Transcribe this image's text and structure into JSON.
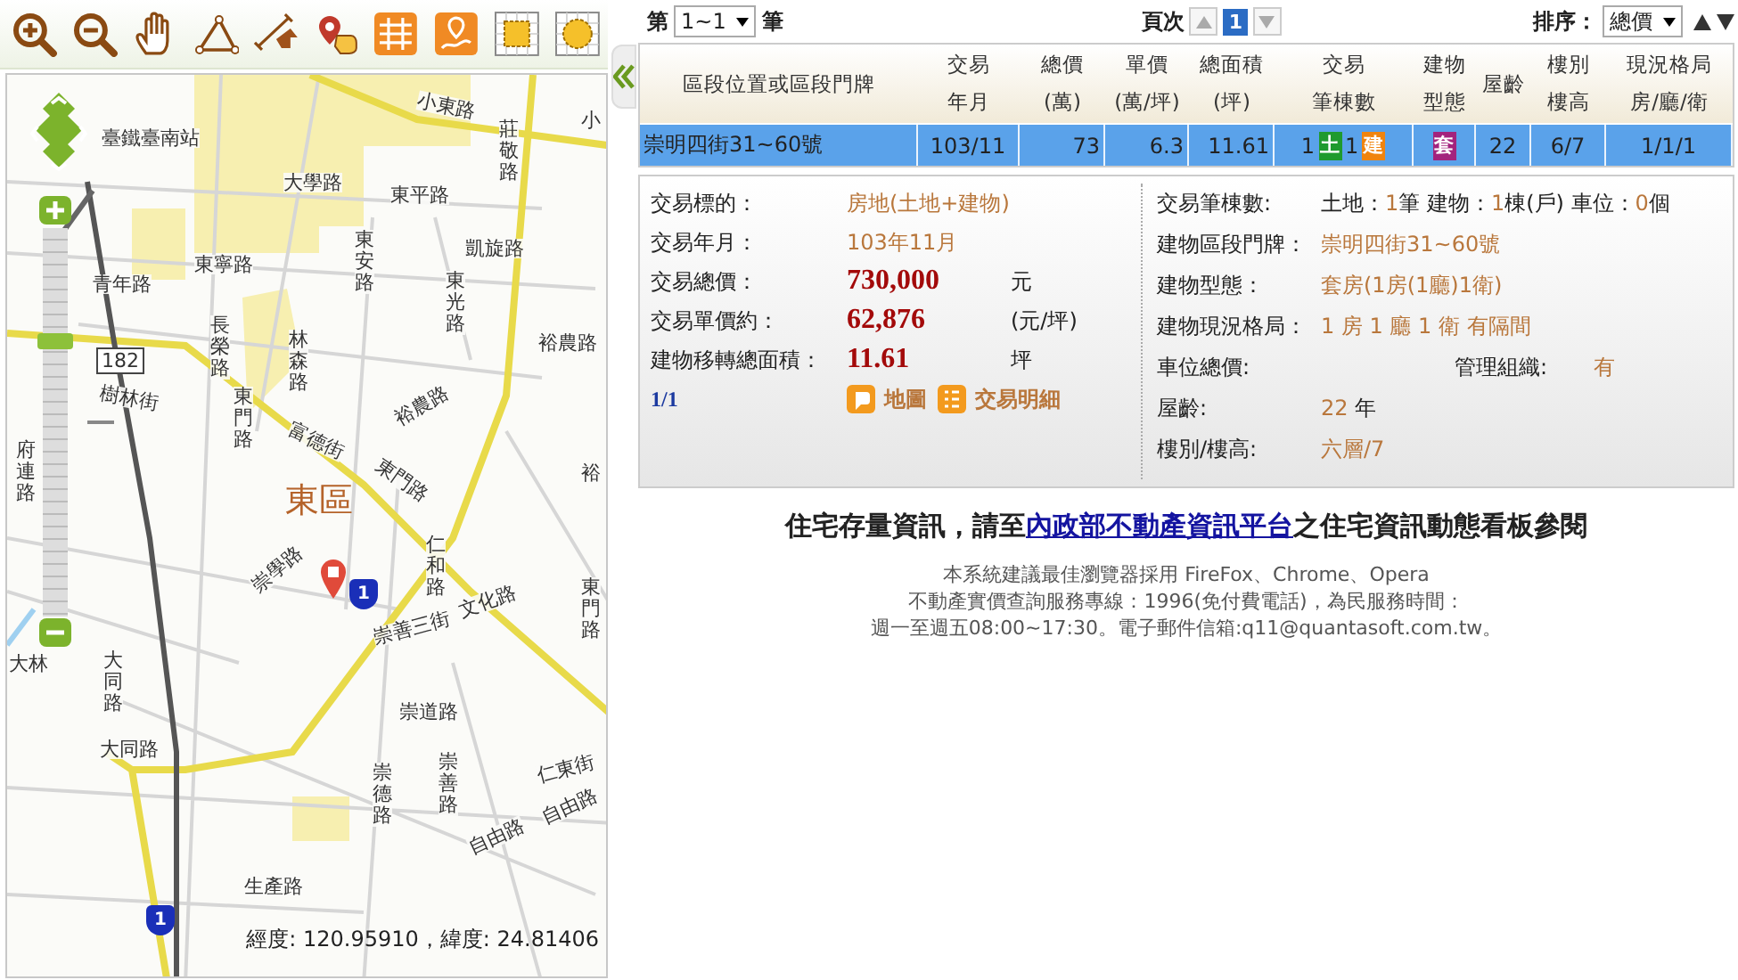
{
  "map": {
    "labels": [
      {
        "text": "臺鐵臺南站",
        "kind": "horizontal"
      },
      {
        "text": "小東路",
        "kind": "horizontal"
      },
      {
        "text": "莊敬路",
        "kind": "vertical"
      },
      {
        "text": "小",
        "kind": "horizontal"
      },
      {
        "text": "大學路",
        "kind": "horizontal"
      },
      {
        "text": "東平路",
        "kind": "horizontal"
      },
      {
        "text": "東安路",
        "kind": "vertical"
      },
      {
        "text": "凱旋路",
        "kind": "horizontal"
      },
      {
        "text": "青年路",
        "kind": "horizontal"
      },
      {
        "text": "東寧路",
        "kind": "horizontal"
      },
      {
        "text": "東光路",
        "kind": "vertical"
      },
      {
        "text": "長榮路",
        "kind": "vertical"
      },
      {
        "text": "林森路",
        "kind": "vertical"
      },
      {
        "text": "裕農路",
        "kind": "horizontal"
      },
      {
        "text": "182",
        "kind": "shield"
      },
      {
        "text": "樹林街",
        "kind": "horizontal"
      },
      {
        "text": "裕農路",
        "kind": "horizontal"
      },
      {
        "text": "東門路",
        "kind": "vertical"
      },
      {
        "text": "府連路",
        "kind": "vertical"
      },
      {
        "text": "富德街",
        "kind": "horizontal"
      },
      {
        "text": "東門路",
        "kind": "horizontal"
      },
      {
        "text": "裕",
        "kind": "horizontal"
      },
      {
        "text": "東區",
        "kind": "district"
      },
      {
        "text": "崇學路",
        "kind": "horizontal"
      },
      {
        "text": "仁和路",
        "kind": "vertical"
      },
      {
        "text": "1",
        "kind": "highway"
      },
      {
        "text": "東門路",
        "kind": "vertical"
      },
      {
        "text": "崇善三街",
        "kind": "horizontal"
      },
      {
        "text": "文化路",
        "kind": "horizontal"
      },
      {
        "text": "大林",
        "kind": "horizontal"
      },
      {
        "text": "大同路",
        "kind": "vertical"
      },
      {
        "text": "大同路",
        "kind": "horizontal"
      },
      {
        "text": "崇道路",
        "kind": "horizontal"
      },
      {
        "text": "崇德路",
        "kind": "vertical"
      },
      {
        "text": "崇善路",
        "kind": "vertical"
      },
      {
        "text": "仁東街",
        "kind": "horizontal"
      },
      {
        "text": "自由路",
        "kind": "horizontal"
      },
      {
        "text": "自由路",
        "kind": "horizontal"
      },
      {
        "text": "生產路",
        "kind": "horizontal"
      },
      {
        "text": "1",
        "kind": "highway"
      }
    ],
    "zoom": {
      "level": 0.72
    },
    "coordinates": "經度: 120.95910，緯度: 24.81406"
  },
  "pager": {
    "prefix": "第",
    "range": "1~1",
    "suffix": "筆",
    "page_label": "頁次",
    "page": "1",
    "sort_label": "排序：",
    "sort_value": "總價"
  },
  "table": {
    "columns": [
      {
        "lines": [
          "區段位置或區段門牌"
        ]
      },
      {
        "lines": [
          "交易",
          "年月"
        ]
      },
      {
        "lines": [
          "總價",
          "(萬)"
        ]
      },
      {
        "lines": [
          "單價",
          "(萬/坪)"
        ]
      },
      {
        "lines": [
          "總面積",
          "(坪)"
        ]
      },
      {
        "lines": [
          "交易",
          "筆棟數"
        ]
      },
      {
        "lines": [
          "建物",
          "型態"
        ]
      },
      {
        "lines": [
          "屋齡"
        ]
      },
      {
        "lines": [
          "樓別",
          "樓高"
        ]
      },
      {
        "lines": [
          "現況格局",
          "房/廳/衛"
        ]
      }
    ],
    "rows": [
      {
        "selected": true,
        "cells": [
          {
            "kind": "text",
            "text": "崇明四街31~60號"
          },
          {
            "kind": "text",
            "text": "103/11"
          },
          {
            "kind": "number",
            "text": "73"
          },
          {
            "kind": "number",
            "text": "6.3"
          },
          {
            "kind": "number",
            "text": "11.61"
          },
          {
            "kind": "badges",
            "items": [
              {
                "count": "1",
                "badge": "土",
                "color": "#1f9a2e"
              },
              {
                "count": "1",
                "badge": "建",
                "color": "#f0840e"
              }
            ]
          },
          {
            "kind": "badges",
            "items": [
              {
                "badge": "套",
                "color": "#a3237d"
              }
            ]
          },
          {
            "kind": "text",
            "text": "22"
          },
          {
            "kind": "text",
            "text": "6/7"
          },
          {
            "kind": "text",
            "text": "1/1/1"
          }
        ]
      }
    ]
  },
  "details": {
    "left": [
      {
        "kind": "plain",
        "label": "交易標的：",
        "value": "房地(土地+建物)"
      },
      {
        "kind": "plain",
        "label": "交易年月：",
        "value": "103年11月"
      },
      {
        "kind": "price",
        "label": "交易總價：",
        "value": "730,000",
        "unit": "元"
      },
      {
        "kind": "price",
        "label": "交易單價約：",
        "value": "62,876",
        "unit": "(元/坪)"
      },
      {
        "kind": "price",
        "label": "建物移轉總面積：",
        "value": "11.61",
        "unit": "坪"
      }
    ],
    "index": "1/1",
    "links": [
      {
        "kind": "map",
        "text": "地圖"
      },
      {
        "kind": "list",
        "text": "交易明細"
      }
    ],
    "right": [
      {
        "label": "交易筆棟數:",
        "parts": [
          {
            "text": "土地：",
            "accent": false
          },
          {
            "text": "1",
            "accent": true
          },
          {
            "text": "筆 建物：",
            "accent": false
          },
          {
            "text": "1",
            "accent": true
          },
          {
            "text": "棟(戶) 車位：",
            "accent": false
          },
          {
            "text": "0",
            "accent": true
          },
          {
            "text": "個",
            "accent": false
          }
        ]
      },
      {
        "label": "建物區段門牌：",
        "parts": [
          {
            "text": "崇明四街31~60號",
            "accent": true
          }
        ]
      },
      {
        "label": "建物型態：",
        "parts": [
          {
            "text": "套房(1房(1廳)1衛)",
            "accent": true
          }
        ]
      },
      {
        "label": "建物現況格局：",
        "parts": [
          {
            "text": "1 房 1 廳 1 衛 有隔間",
            "accent": true
          }
        ]
      },
      {
        "label": "車位總價:",
        "side_label": "管理組織:",
        "side_value": "有"
      },
      {
        "label": "屋齡:",
        "parts": [
          {
            "text": "22",
            "accent": true
          },
          {
            "text": " 年",
            "accent": false
          }
        ]
      },
      {
        "label": "樓別/樓高:",
        "parts": [
          {
            "text": "六層/7",
            "accent": true
          }
        ]
      }
    ]
  },
  "notice": {
    "before": "住宅存量資訊，請至",
    "link": "內政部不動產資訊平台",
    "after": "之住宅資訊動態看板參閱"
  },
  "footer": [
    "本系統建議最佳瀏覽器採用 FireFox、Chrome、Opera",
    "不動產實價查詢服務專線：1996(免付費電話)，為民服務時間：",
    "週一至週五08:00~17:30。電子郵件信箱:q11@quantasoft.com.tw。"
  ]
}
